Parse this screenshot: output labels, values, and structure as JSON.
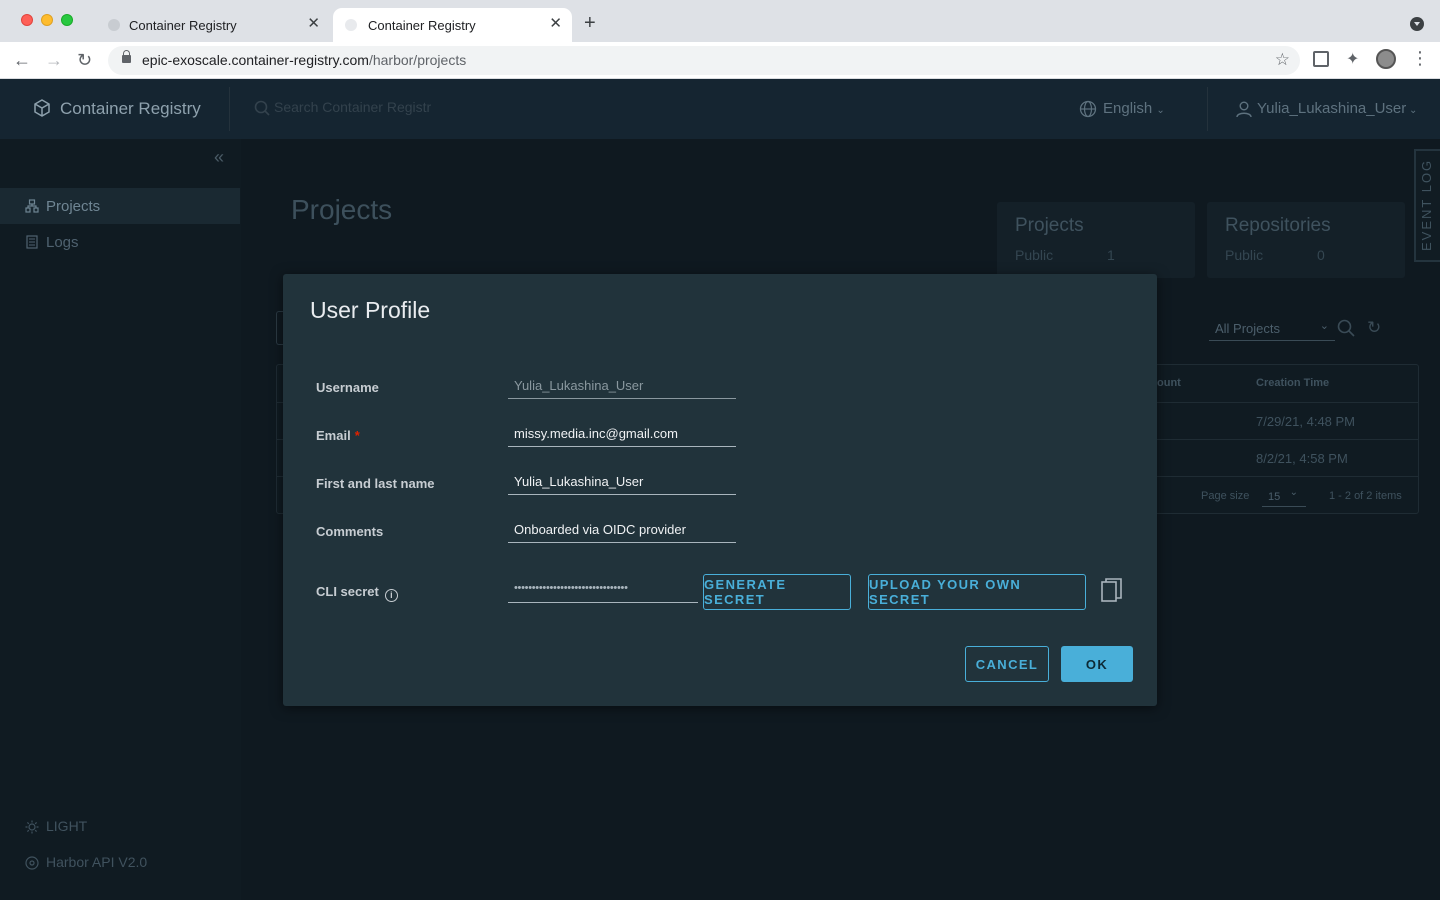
{
  "browser": {
    "tabs": [
      {
        "title": "Container Registry"
      },
      {
        "title": "Container Registry"
      }
    ],
    "url_host": "epic-exoscale.container-registry.com",
    "url_path": "/harbor/projects"
  },
  "header": {
    "app_title": "Container Registry",
    "search_placeholder": "Search Container Registr",
    "language": "English",
    "user": "Yulia_Lukashina_User"
  },
  "sidebar": {
    "items": [
      {
        "label": "Projects"
      },
      {
        "label": "Logs"
      }
    ],
    "theme_toggle": "LIGHT",
    "api_link": "Harbor API V2.0"
  },
  "page": {
    "title": "Projects",
    "cards": [
      {
        "title": "Projects",
        "label": "Public",
        "value": "1"
      },
      {
        "title": "Repositories",
        "label": "Public",
        "value": "0"
      }
    ],
    "event_log": "EVENT LOG",
    "filter": "All Projects",
    "table": {
      "col_count": "ount",
      "col_time": "Creation Time",
      "rows": [
        {
          "time": "7/29/21, 4:48 PM"
        },
        {
          "time": "8/2/21, 4:58 PM"
        }
      ],
      "page_size_label": "Page size",
      "page_size": "15",
      "count": "1 - 2 of 2 items"
    }
  },
  "modal": {
    "title": "User Profile",
    "username_label": "Username",
    "username": "Yulia_Lukashina_User",
    "email_label": "Email",
    "email_required": "*",
    "email": "missy.media.inc@gmail.com",
    "name_label": "First and last name",
    "name": "Yulia_Lukashina_User",
    "comments_label": "Comments",
    "comments": "Onboarded via OIDC provider",
    "cli_label": "CLI secret",
    "cli_secret": "••••••••••••••••••••••••••••••••",
    "generate_label": "GENERATE SECRET",
    "upload_label": "UPLOAD YOUR OWN SECRET",
    "cancel_label": "CANCEL",
    "ok_label": "OK"
  },
  "colors": {
    "accent": "#49afd9",
    "modal_bg": "#21333b",
    "header_bg": "#152531"
  }
}
